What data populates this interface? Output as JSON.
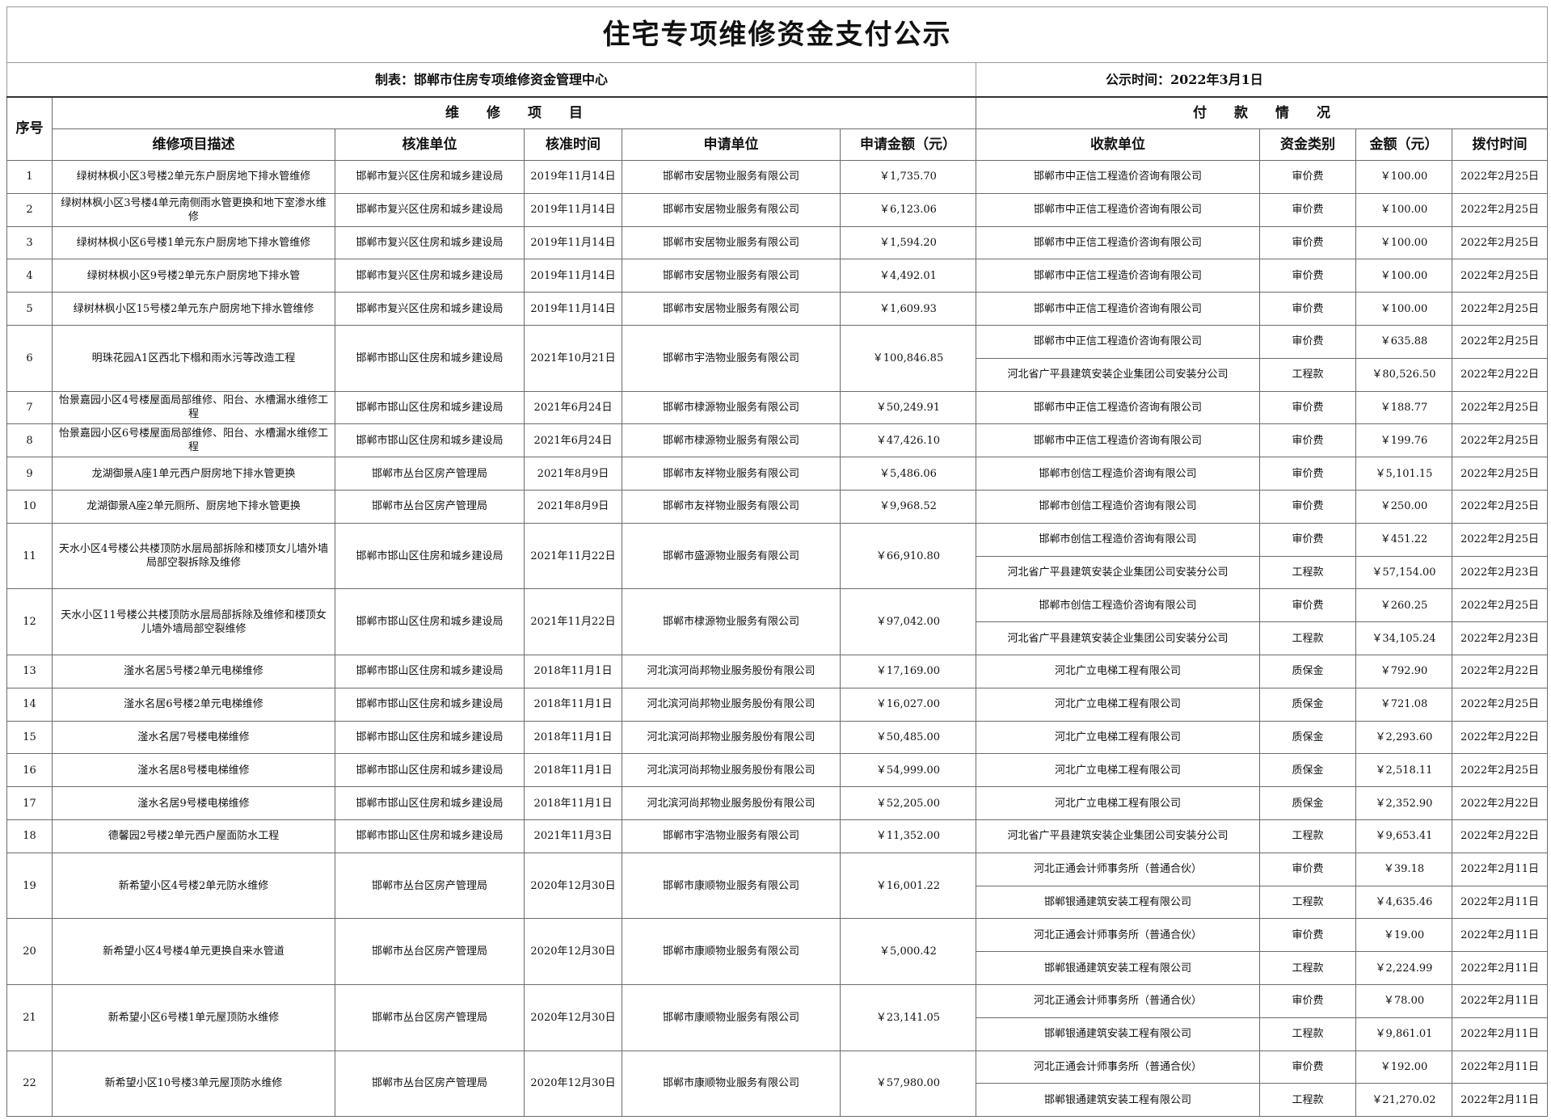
{
  "title": "住宅专项维修资金支付公示",
  "meta": {
    "maker": "制表：邯郸市住房专项维修资金管理中心",
    "date": "公示时间：2022年3月1日"
  },
  "groups": {
    "seq": "序号",
    "project": "维　　修　　项　　目",
    "payment": "付　　款　　情　　况"
  },
  "columns": [
    "维修项目描述",
    "核准单位",
    "核准时间",
    "申请单位",
    "申请金额（元）",
    "收款单位",
    "资金类别",
    "金额（元）",
    "拨付时间"
  ],
  "rows": [
    {
      "no": "1",
      "desc": "绿树林枫小区3号楼2单元东户厨房地下排水管维修",
      "approver": "邯郸市复兴区住房和城乡建设局",
      "approve_date": "2019年11月14日",
      "applicant": "邯郸市安居物业服务有限公司",
      "amount": "￥1,735.70",
      "payments": [
        {
          "payee": "邯郸市中正信工程造价咨询有限公司",
          "type": "审价费",
          "amt": "￥100.00",
          "date": "2022年2月25日"
        }
      ]
    },
    {
      "no": "2",
      "desc": "绿树林枫小区3号楼4单元南侧雨水管更换和地下室渗水维修",
      "approver": "邯郸市复兴区住房和城乡建设局",
      "approve_date": "2019年11月14日",
      "applicant": "邯郸市安居物业服务有限公司",
      "amount": "￥6,123.06",
      "payments": [
        {
          "payee": "邯郸市中正信工程造价咨询有限公司",
          "type": "审价费",
          "amt": "￥100.00",
          "date": "2022年2月25日"
        }
      ]
    },
    {
      "no": "3",
      "desc": "绿树林枫小区6号楼1单元东户厨房地下排水管维修",
      "approver": "邯郸市复兴区住房和城乡建设局",
      "approve_date": "2019年11月14日",
      "applicant": "邯郸市安居物业服务有限公司",
      "amount": "￥1,594.20",
      "payments": [
        {
          "payee": "邯郸市中正信工程造价咨询有限公司",
          "type": "审价费",
          "amt": "￥100.00",
          "date": "2022年2月25日"
        }
      ]
    },
    {
      "no": "4",
      "desc": "绿树林枫小区9号楼2单元东户厨房地下排水管",
      "approver": "邯郸市复兴区住房和城乡建设局",
      "approve_date": "2019年11月14日",
      "applicant": "邯郸市安居物业服务有限公司",
      "amount": "￥4,492.01",
      "payments": [
        {
          "payee": "邯郸市中正信工程造价咨询有限公司",
          "type": "审价费",
          "amt": "￥100.00",
          "date": "2022年2月25日"
        }
      ]
    },
    {
      "no": "5",
      "desc": "绿树林枫小区15号楼2单元东户厨房地下排水管维修",
      "approver": "邯郸市复兴区住房和城乡建设局",
      "approve_date": "2019年11月14日",
      "applicant": "邯郸市安居物业服务有限公司",
      "amount": "￥1,609.93",
      "payments": [
        {
          "payee": "邯郸市中正信工程造价咨询有限公司",
          "type": "审价费",
          "amt": "￥100.00",
          "date": "2022年2月25日"
        }
      ]
    },
    {
      "no": "6",
      "desc": "明珠花园A1区西北下榻和雨水污等改造工程",
      "approver": "邯郸市邯山区住房和城乡建设局",
      "approve_date": "2021年10月21日",
      "applicant": "邯郸市宇浩物业服务有限公司",
      "amount": "￥100,846.85",
      "payments": [
        {
          "payee": "邯郸市中正信工程造价咨询有限公司",
          "type": "审价费",
          "amt": "￥635.88",
          "date": "2022年2月25日"
        },
        {
          "payee": "河北省广平县建筑安装企业集团公司安装分公司",
          "type": "工程款",
          "amt": "￥80,526.50",
          "date": "2022年2月22日"
        }
      ]
    },
    {
      "no": "7",
      "desc": "怡景嘉园小区4号楼屋面局部维修、阳台、水槽漏水维修工程",
      "approver": "邯郸市邯山区住房和城乡建设局",
      "approve_date": "2021年6月24日",
      "applicant": "邯郸市棣源物业服务有限公司",
      "amount": "￥50,249.91",
      "payments": [
        {
          "payee": "邯郸市中正信工程造价咨询有限公司",
          "type": "审价费",
          "amt": "￥188.77",
          "date": "2022年2月25日"
        }
      ]
    },
    {
      "no": "8",
      "desc": "怡景嘉园小区6号楼屋面局部维修、阳台、水槽漏水维修工程",
      "approver": "邯郸市邯山区住房和城乡建设局",
      "approve_date": "2021年6月24日",
      "applicant": "邯郸市棣源物业服务有限公司",
      "amount": "￥47,426.10",
      "payments": [
        {
          "payee": "邯郸市中正信工程造价咨询有限公司",
          "type": "审价费",
          "amt": "￥199.76",
          "date": "2022年2月25日"
        }
      ]
    },
    {
      "no": "9",
      "desc": "龙湖御景A座1单元西户厨房地下排水管更换",
      "approver": "邯郸市丛台区房产管理局",
      "approve_date": "2021年8月9日",
      "applicant": "邯郸市友祥物业服务有限公司",
      "amount": "￥5,486.06",
      "payments": [
        {
          "payee": "邯郸市创信工程造价咨询有限公司",
          "type": "审价费",
          "amt": "￥5,101.15",
          "date": "2022年2月25日"
        }
      ]
    },
    {
      "no": "10",
      "desc": "龙湖御景A座2单元厕所、厨房地下排水管更换",
      "approver": "邯郸市丛台区房产管理局",
      "approve_date": "2021年8月9日",
      "applicant": "邯郸市友祥物业服务有限公司",
      "amount": "￥9,968.52",
      "payments": [
        {
          "payee": "邯郸市创信工程造价咨询有限公司",
          "type": "审价费",
          "amt": "￥250.00",
          "date": "2022年2月25日"
        }
      ]
    },
    {
      "no": "11",
      "desc": "天水小区4号楼公共楼顶防水层局部拆除和楼顶女儿墙外墙局部空裂拆除及维修",
      "approver": "邯郸市邯山区住房和城乡建设局",
      "approve_date": "2021年11月22日",
      "applicant": "邯郸市盛源物业服务有限公司",
      "amount": "￥66,910.80",
      "payments": [
        {
          "payee": "邯郸市创信工程造价咨询有限公司",
          "type": "审价费",
          "amt": "￥451.22",
          "date": "2022年2月25日"
        },
        {
          "payee": "河北省广平县建筑安装企业集团公司安装分公司",
          "type": "工程款",
          "amt": "￥57,154.00",
          "date": "2022年2月23日"
        }
      ]
    },
    {
      "no": "12",
      "desc": "天水小区11号楼公共楼顶防水层局部拆除及维修和楼顶女儿墙外墙局部空裂维修",
      "approver": "邯郸市邯山区住房和城乡建设局",
      "approve_date": "2021年11月22日",
      "applicant": "邯郸市棣源物业服务有限公司",
      "amount": "￥97,042.00",
      "payments": [
        {
          "payee": "邯郸市创信工程造价咨询有限公司",
          "type": "审价费",
          "amt": "￥260.25",
          "date": "2022年2月25日"
        },
        {
          "payee": "河北省广平县建筑安装企业集团公司安装分公司",
          "type": "工程款",
          "amt": "￥34,105.24",
          "date": "2022年2月23日"
        }
      ]
    },
    {
      "no": "13",
      "desc": "滏水名居5号楼2单元电梯维修",
      "approver": "邯郸市邯山区住房和城乡建设局",
      "approve_date": "2018年11月1日",
      "applicant": "河北滨河尚邦物业服务股份有限公司",
      "amount": "￥17,169.00",
      "payments": [
        {
          "payee": "河北广立电梯工程有限公司",
          "type": "质保金",
          "amt": "￥792.90",
          "date": "2022年2月22日"
        }
      ]
    },
    {
      "no": "14",
      "desc": "滏水名居6号楼2单元电梯维修",
      "approver": "邯郸市邯山区住房和城乡建设局",
      "approve_date": "2018年11月1日",
      "applicant": "河北滨河尚邦物业服务股份有限公司",
      "amount": "￥16,027.00",
      "payments": [
        {
          "payee": "河北广立电梯工程有限公司",
          "type": "质保金",
          "amt": "￥721.08",
          "date": "2022年2月25日"
        }
      ]
    },
    {
      "no": "15",
      "desc": "滏水名居7号楼电梯维修",
      "approver": "邯郸市邯山区住房和城乡建设局",
      "approve_date": "2018年11月1日",
      "applicant": "河北滨河尚邦物业服务股份有限公司",
      "amount": "￥50,485.00",
      "payments": [
        {
          "payee": "河北广立电梯工程有限公司",
          "type": "质保金",
          "amt": "￥2,293.60",
          "date": "2022年2月22日"
        }
      ]
    },
    {
      "no": "16",
      "desc": "滏水名居8号楼电梯维修",
      "approver": "邯郸市邯山区住房和城乡建设局",
      "approve_date": "2018年11月1日",
      "applicant": "河北滨河尚邦物业服务股份有限公司",
      "amount": "￥54,999.00",
      "payments": [
        {
          "payee": "河北广立电梯工程有限公司",
          "type": "质保金",
          "amt": "￥2,518.11",
          "date": "2022年2月25日"
        }
      ]
    },
    {
      "no": "17",
      "desc": "滏水名居9号楼电梯维修",
      "approver": "邯郸市邯山区住房和城乡建设局",
      "approve_date": "2018年11月1日",
      "applicant": "河北滨河尚邦物业服务股份有限公司",
      "amount": "￥52,205.00",
      "payments": [
        {
          "payee": "河北广立电梯工程有限公司",
          "type": "质保金",
          "amt": "￥2,352.90",
          "date": "2022年2月22日"
        }
      ]
    },
    {
      "no": "18",
      "desc": "德馨园2号楼2单元西户屋面防水工程",
      "approver": "邯郸市邯山区住房和城乡建设局",
      "approve_date": "2021年11月3日",
      "applicant": "邯郸市宇浩物业服务有限公司",
      "amount": "￥11,352.00",
      "payments": [
        {
          "payee": "河北省广平县建筑安装企业集团公司安装分公司",
          "type": "工程款",
          "amt": "￥9,653.41",
          "date": "2022年2月22日"
        }
      ]
    },
    {
      "no": "19",
      "desc": "新希望小区4号楼2单元防水维修",
      "approver": "邯郸市丛台区房产管理局",
      "approve_date": "2020年12月30日",
      "applicant": "邯郸市康顺物业服务有限公司",
      "amount": "￥16,001.22",
      "payments": [
        {
          "payee": "河北正通会计师事务所（普通合伙）",
          "type": "审价费",
          "amt": "￥39.18",
          "date": "2022年2月11日"
        },
        {
          "payee": "邯郸银通建筑安装工程有限公司",
          "type": "工程款",
          "amt": "￥4,635.46",
          "date": "2022年2月11日"
        }
      ]
    },
    {
      "no": "20",
      "desc": "新希望小区4号楼4单元更换自来水管道",
      "approver": "邯郸市丛台区房产管理局",
      "approve_date": "2020年12月30日",
      "applicant": "邯郸市康顺物业服务有限公司",
      "amount": "￥5,000.42",
      "payments": [
        {
          "payee": "河北正通会计师事务所（普通合伙）",
          "type": "审价费",
          "amt": "￥19.00",
          "date": "2022年2月11日"
        },
        {
          "payee": "邯郸银通建筑安装工程有限公司",
          "type": "工程款",
          "amt": "￥2,224.99",
          "date": "2022年2月11日"
        }
      ]
    },
    {
      "no": "21",
      "desc": "新希望小区6号楼1单元屋顶防水维修",
      "approver": "邯郸市丛台区房产管理局",
      "approve_date": "2020年12月30日",
      "applicant": "邯郸市康顺物业服务有限公司",
      "amount": "￥23,141.05",
      "payments": [
        {
          "payee": "河北正通会计师事务所（普通合伙）",
          "type": "审价费",
          "amt": "￥78.00",
          "date": "2022年2月11日"
        },
        {
          "payee": "邯郸银通建筑安装工程有限公司",
          "type": "工程款",
          "amt": "￥9,861.01",
          "date": "2022年2月11日"
        }
      ]
    },
    {
      "no": "22",
      "desc": "新希望小区10号楼3单元屋顶防水维修",
      "approver": "邯郸市丛台区房产管理局",
      "approve_date": "2020年12月30日",
      "applicant": "邯郸市康顺物业服务有限公司",
      "amount": "￥57,980.00",
      "payments": [
        {
          "payee": "河北正通会计师事务所（普通合伙）",
          "type": "审价费",
          "amt": "￥192.00",
          "date": "2022年2月11日"
        },
        {
          "payee": "邯郸银通建筑安装工程有限公司",
          "type": "工程款",
          "amt": "￥21,270.02",
          "date": "2022年2月11日"
        }
      ]
    }
  ]
}
